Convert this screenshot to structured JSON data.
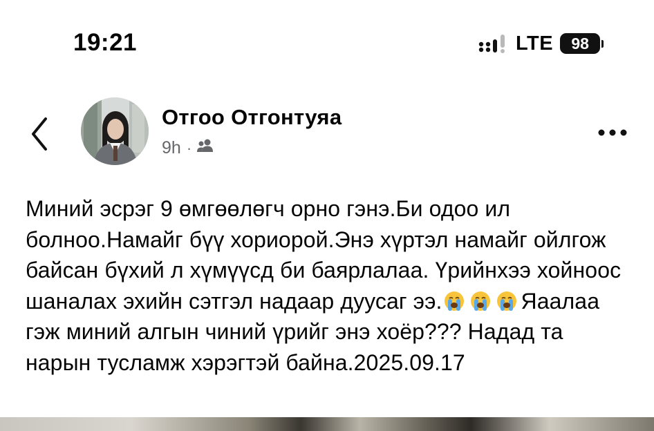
{
  "status_bar": {
    "time": "19:21",
    "network": "LTE",
    "battery": "98"
  },
  "post": {
    "author_name": "Отгоо Отгонтуяа",
    "time_ago": "9h",
    "meta_separator": "·",
    "audience_icon": "friends-icon",
    "text_part1": "Миний эсрэг 9 өмгөөлөгч орно гэнэ.Би одоо ил болноо.Намайг бүү хориорой.Энэ хүртэл намайг ойлгож байсан бүхий л хүмүүсд би баярлалаа. Үрийнхээ хойноос шаналах эхийн сэтгэл надаар дуусаг ээ.",
    "emoji": "loudly-crying-face-emoji",
    "text_part2": "Яаалаа гэж миний алгын чиний үрийг энэ хоёр??? Надад та нарын тусламж хэрэгтэй байна.2025.09.17"
  }
}
